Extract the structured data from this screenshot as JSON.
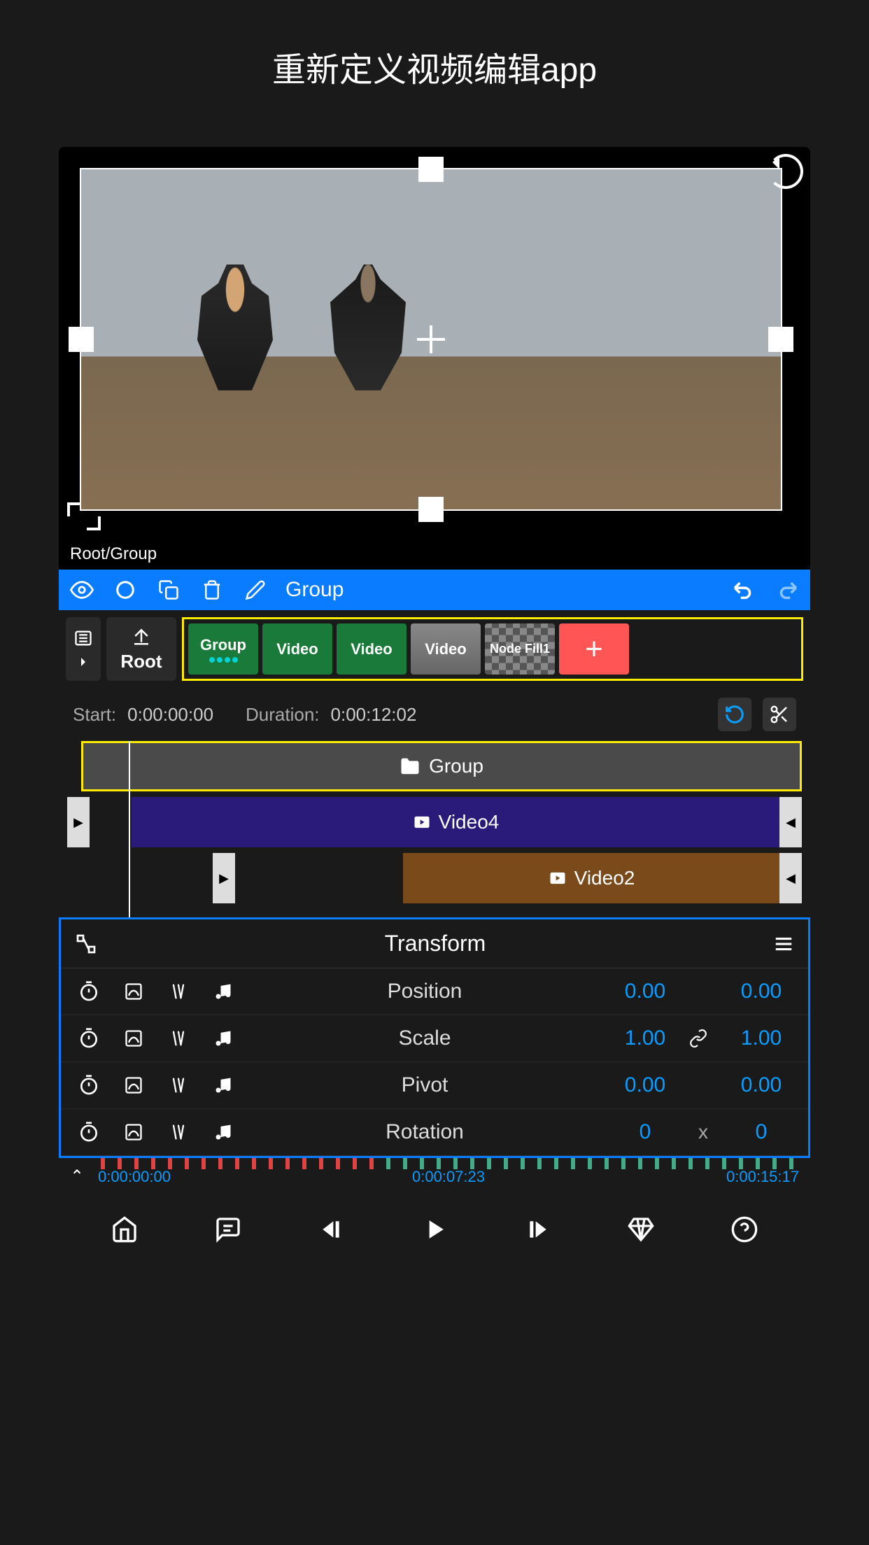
{
  "page_title": "重新定义视频编辑app",
  "breadcrumb": "Root/Group",
  "toolbar": {
    "label": "Group"
  },
  "root_button": "Root",
  "clips": [
    {
      "label": "Group",
      "type": "group"
    },
    {
      "label": "Video",
      "type": "video"
    },
    {
      "label": "Video",
      "type": "video"
    },
    {
      "label": "Video",
      "type": "thumb"
    },
    {
      "label": "Node Fill1",
      "type": "fill"
    }
  ],
  "time_info": {
    "start_label": "Start:",
    "start_value": "0:00:00:00",
    "duration_label": "Duration:",
    "duration_value": "0:00:12:02"
  },
  "tracks": {
    "group": "Group",
    "video4": "Video4",
    "video2": "Video2"
  },
  "transform": {
    "title": "Transform",
    "props": [
      {
        "name": "Position",
        "v1": "0.00",
        "sep": "",
        "v2": "0.00"
      },
      {
        "name": "Scale",
        "v1": "1.00",
        "sep": "link",
        "v2": "1.00"
      },
      {
        "name": "Pivot",
        "v1": "0.00",
        "sep": "",
        "v2": "0.00"
      },
      {
        "name": "Rotation",
        "v1": "0",
        "sep": "x",
        "v2": "0"
      }
    ]
  },
  "ruler": {
    "t1": "0:00:00:00",
    "t2": "0:00:07:23",
    "t3": "0:00:15:17"
  }
}
